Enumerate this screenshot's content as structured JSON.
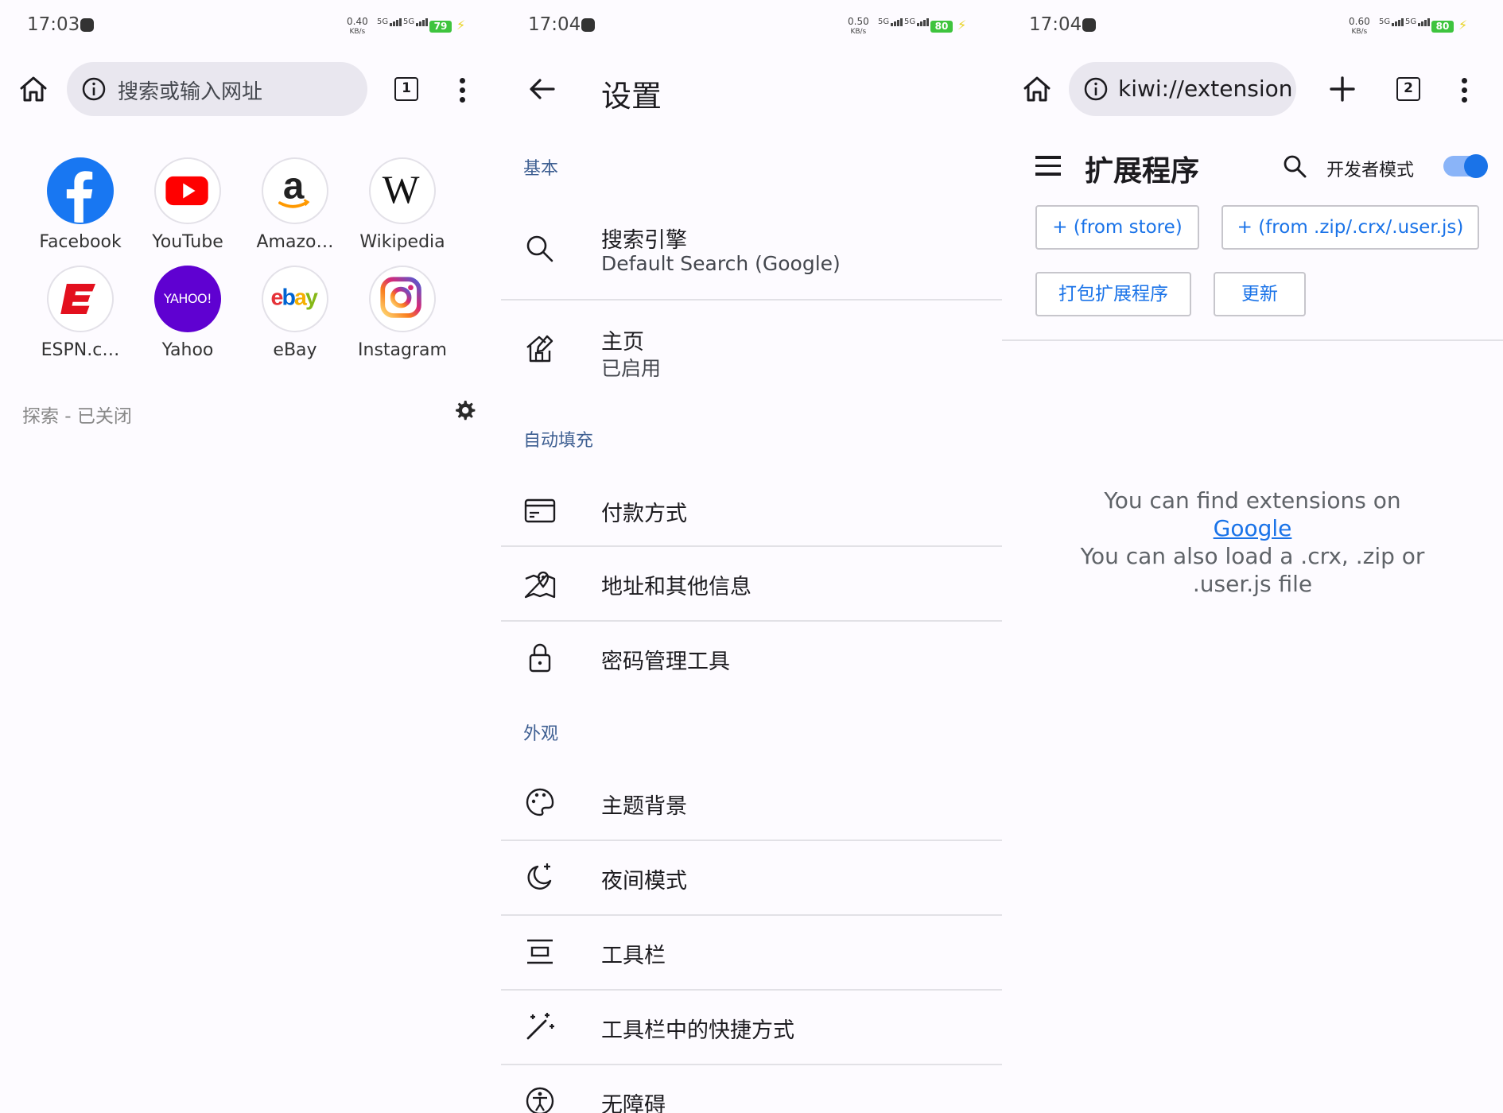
{
  "screens": [
    {
      "status": {
        "time": "17:03",
        "rate_top": "0.40",
        "rate_bottom": "KB/s",
        "sig1": "5G",
        "sig2": "5G",
        "battery": "79"
      },
      "omnibox": {
        "placeholder": "搜索或输入网址"
      },
      "tab_count": "1",
      "tiles": [
        {
          "label": "Facebook",
          "icon": "facebook-logo"
        },
        {
          "label": "YouTube",
          "icon": "youtube-logo"
        },
        {
          "label": "Amazo…",
          "icon": "amazon-logo"
        },
        {
          "label": "Wikipedia",
          "icon": "wikipedia-logo"
        },
        {
          "label": "ESPN.c…",
          "icon": "espn-logo"
        },
        {
          "label": "Yahoo",
          "icon": "yahoo-logo",
          "logo_text": "YAHOO!"
        },
        {
          "label": "eBay",
          "icon": "ebay-logo"
        },
        {
          "label": "Instagram",
          "icon": "instagram-logo"
        }
      ],
      "discover": "探索 - 已关闭"
    },
    {
      "status": {
        "time": "17:04",
        "rate_top": "0.50",
        "rate_bottom": "KB/s",
        "sig1": "5G",
        "sig2": "5G",
        "battery": "80"
      },
      "title": "设置",
      "sections": {
        "basic": "基本",
        "autofill": "自动填充",
        "appearance": "外观"
      },
      "items": {
        "search_engine": {
          "title": "搜索引擎",
          "subtitle": "Default Search (Google)",
          "icon": "search-icon"
        },
        "homepage": {
          "title": "主页",
          "subtitle": "已启用",
          "icon": "home-edit-icon"
        },
        "payment": {
          "title": "付款方式",
          "icon": "credit-card-icon"
        },
        "address": {
          "title": "地址和其他信息",
          "icon": "map-pin-icon"
        },
        "passwords": {
          "title": "密码管理工具",
          "icon": "lock-icon"
        },
        "theme": {
          "title": "主题背景",
          "icon": "palette-icon"
        },
        "night": {
          "title": "夜间模式",
          "icon": "night-mode-icon"
        },
        "toolbar": {
          "title": "工具栏",
          "icon": "toolbar-icon"
        },
        "toolbar_shortcuts": {
          "title": "工具栏中的快捷方式",
          "icon": "magic-wand-icon"
        },
        "accessibility": {
          "title": "无障碍",
          "icon": "accessibility-icon"
        }
      }
    },
    {
      "status": {
        "time": "17:04",
        "rate_top": "0.60",
        "rate_bottom": "KB/s",
        "sig1": "5G",
        "sig2": "5G",
        "battery": "80"
      },
      "url": "kiwi://extensions",
      "tab_count": "2",
      "title": "扩展程序",
      "dev_mode_label": "开发者模式",
      "dev_mode_on": true,
      "buttons": {
        "from_store": "+ (from store)",
        "from_zip": "+ (from .zip/.crx/.user.js)",
        "pack": "打包扩展程序",
        "update": "更新"
      },
      "empty": {
        "line1": "You can find extensions on",
        "link": "Google",
        "line2": "You can also load a .crx, .zip or",
        "line3": ".user.js file"
      }
    }
  ],
  "colors": {
    "accent": "#1a73e8",
    "section": "#3e5f92",
    "battery": "#3ec43e"
  }
}
